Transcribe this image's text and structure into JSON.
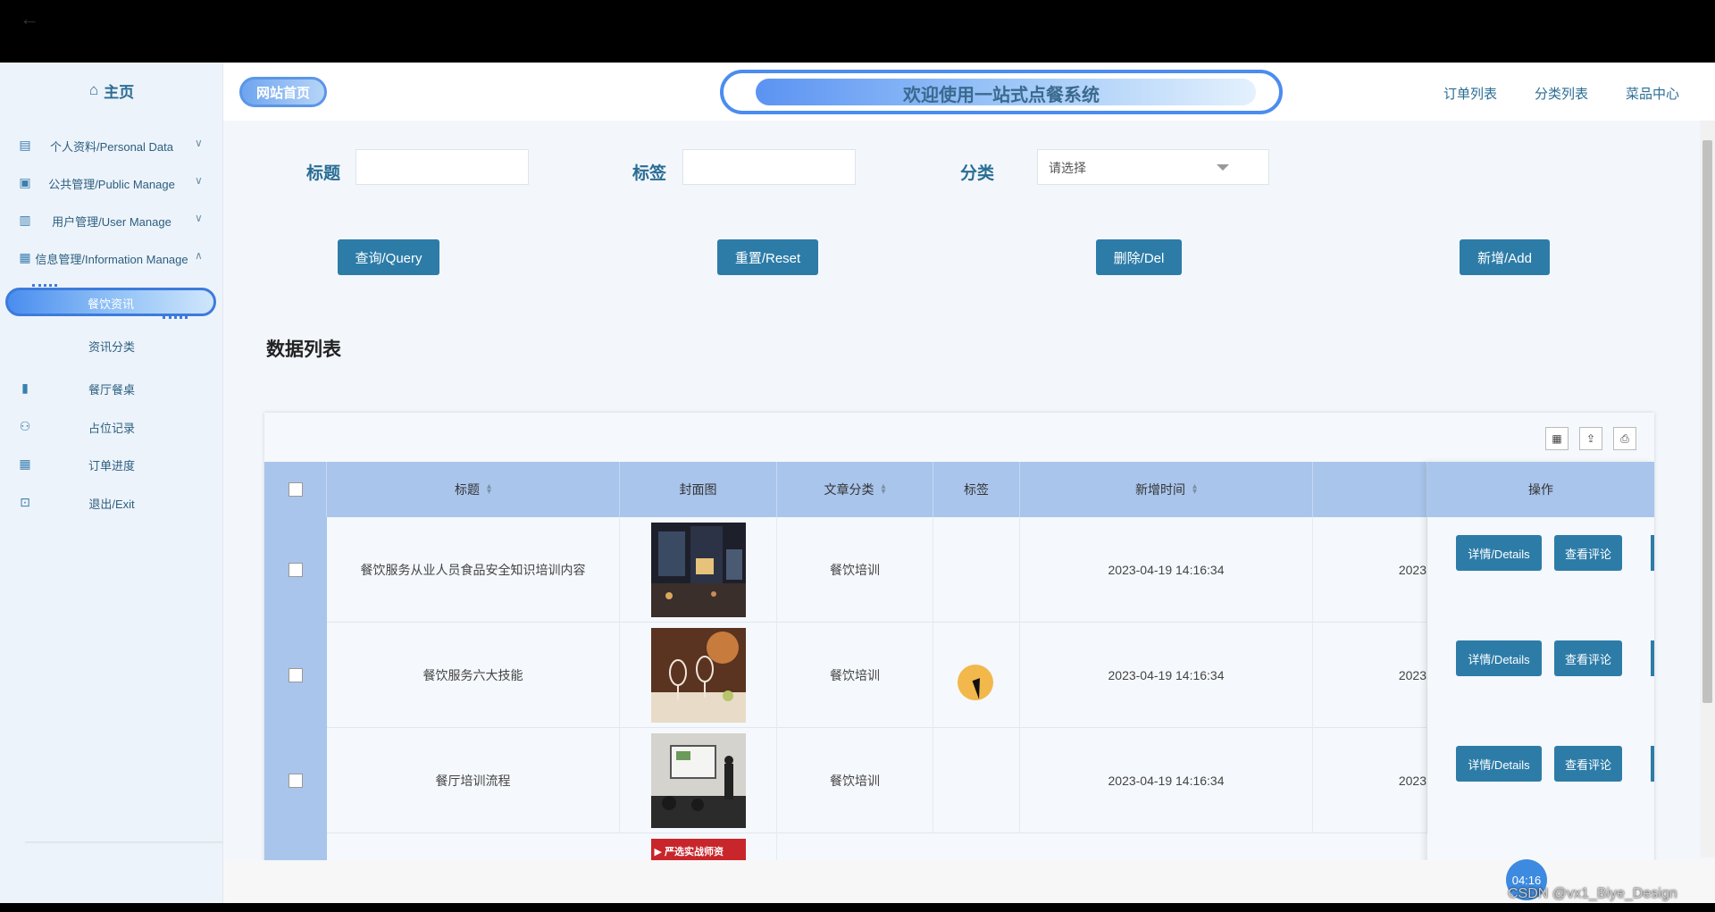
{
  "sidebar": {
    "home": "主页",
    "items": [
      {
        "label": "个人资料/Personal Data",
        "icon": "file-icon",
        "expanded": false
      },
      {
        "label": "公共管理/Public Manage",
        "icon": "clipboard-icon",
        "expanded": false
      },
      {
        "label": "用户管理/User Manage",
        "icon": "building-icon",
        "expanded": false
      },
      {
        "label": "信息管理/Information Manage",
        "icon": "chart-icon",
        "expanded": true
      }
    ],
    "active": "餐饮资讯",
    "sub_items": [
      "资讯分类"
    ],
    "bottom_items": [
      {
        "label": "餐厅餐桌",
        "icon": "bookmark-icon"
      },
      {
        "label": "占位记录",
        "icon": "badge-icon"
      },
      {
        "label": "订单进度",
        "icon": "calendar-icon"
      },
      {
        "label": "退出/Exit",
        "icon": "exit-icon"
      }
    ]
  },
  "header": {
    "site_home": "网站首页",
    "banner": "欢迎使用一站式点餐系统",
    "nav": [
      "订单列表",
      "分类列表",
      "菜品中心"
    ]
  },
  "filters": {
    "title_label": "标题",
    "tag_label": "标签",
    "category_label": "分类",
    "category_placeholder": "请选择"
  },
  "buttons": {
    "query": "查询/Query",
    "reset": "重置/Reset",
    "delete": "删除/Del",
    "add": "新增/Add"
  },
  "list_title": "数据列表",
  "table": {
    "columns": [
      "标题",
      "封面图",
      "文章分类",
      "标签",
      "新增时间",
      "操作"
    ],
    "rows": [
      {
        "title": "餐饮服务从业人员食品安全知识培训内容",
        "category": "餐饮培训",
        "tag": "",
        "time": "2023-04-19 14:16:34",
        "time2": "2023"
      },
      {
        "title": "餐饮服务六大技能",
        "category": "餐饮培训",
        "tag": "",
        "time": "2023-04-19 14:16:34",
        "time2": "2023"
      },
      {
        "title": "餐厅培训流程",
        "category": "餐饮培训",
        "tag": "",
        "time": "2023-04-19 14:16:34",
        "time2": "2023"
      }
    ],
    "partial_thumb_text": "▶ 严选实战师资",
    "op_details": "详情/Details",
    "op_comments": "查看评论"
  },
  "overlay": {
    "timer": "04:16",
    "watermark": "CSDN @vx1_Biye_Design"
  }
}
